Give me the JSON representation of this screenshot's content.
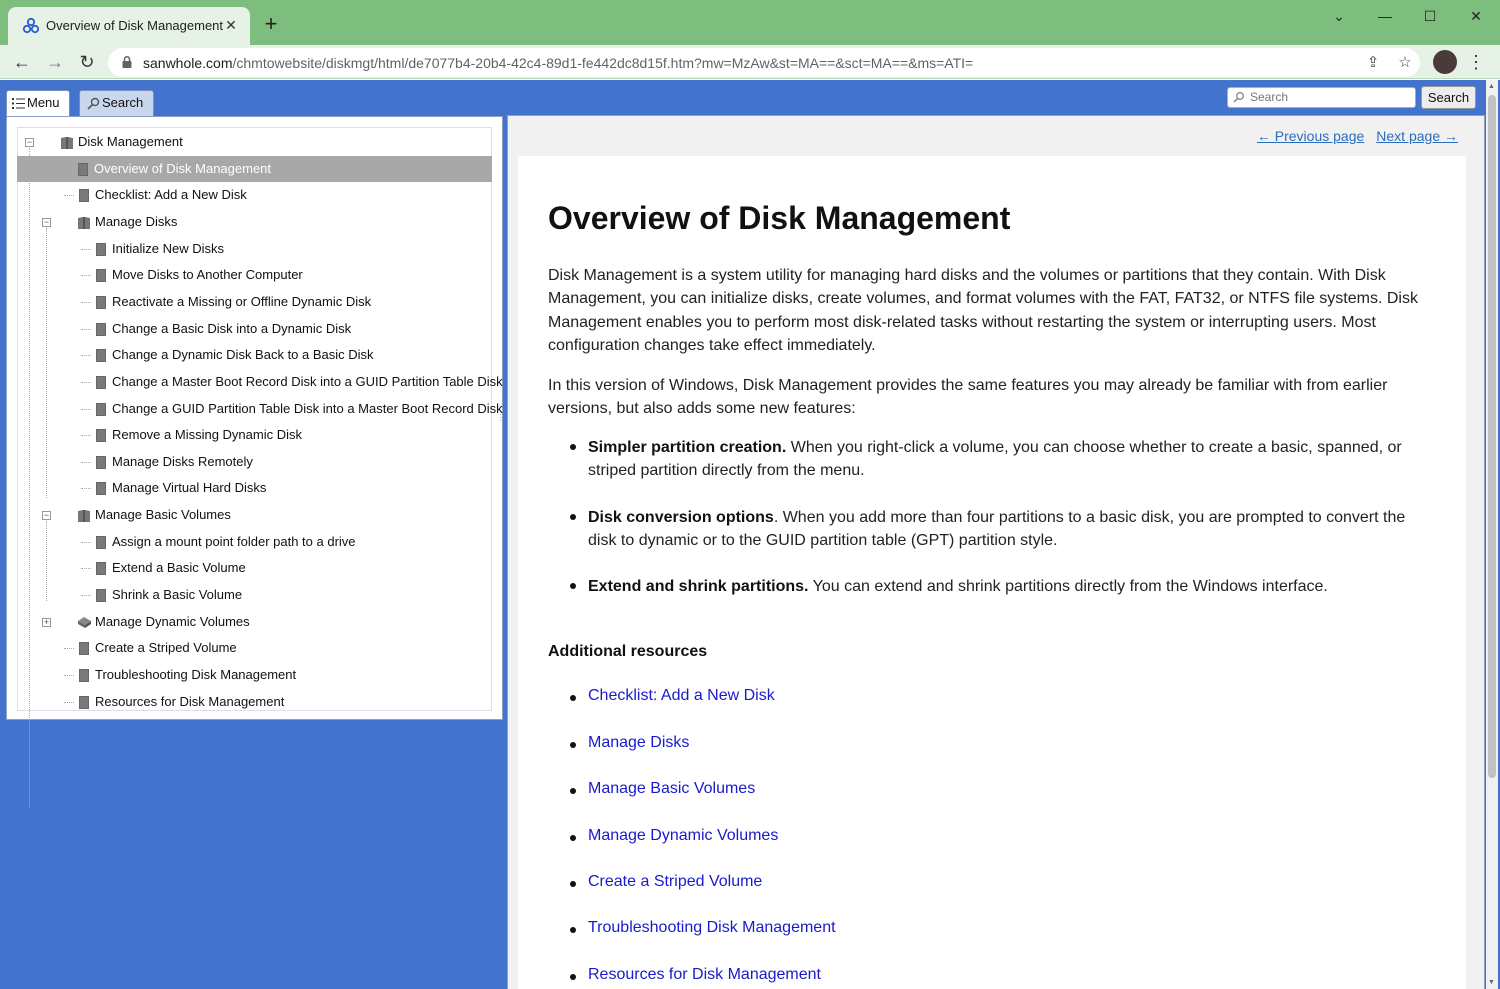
{
  "browser": {
    "tab_title": "Overview of Disk Management",
    "tab_close": "✕",
    "new_tab": "+",
    "minimize": "—",
    "maximize": "☐",
    "close": "✕",
    "chevron": "⌄",
    "url_host": "sanwhole.com",
    "url_path": "/chmtowebsite/diskmgt/html/de7077b4-20b4-42c4-89d1-fe442dc8d15f.htm?mw=MzAw&st=MA==&sct=MA==&ms=ATI=",
    "back": "←",
    "forward": "→",
    "reload": "↻",
    "kebab": "⋮",
    "share": "⇪",
    "star": "☆"
  },
  "panel_tabs": {
    "menu": "Menu",
    "search": "Search"
  },
  "top_search": {
    "placeholder": "Search",
    "button": "Search"
  },
  "tree": [
    {
      "label": "Disk Management",
      "level": 0,
      "type": "book",
      "toggle": "−"
    },
    {
      "label": "Overview of Disk Management",
      "level": 1,
      "type": "page",
      "selected": true
    },
    {
      "label": "Checklist: Add a New Disk",
      "level": 1,
      "type": "page"
    },
    {
      "label": "Manage Disks",
      "level": 1,
      "type": "book",
      "toggle": "−"
    },
    {
      "label": "Initialize New Disks",
      "level": 2,
      "type": "page"
    },
    {
      "label": "Move Disks to Another Computer",
      "level": 2,
      "type": "page"
    },
    {
      "label": "Reactivate a Missing or Offline Dynamic Disk",
      "level": 2,
      "type": "page"
    },
    {
      "label": "Change a Basic Disk into a Dynamic Disk",
      "level": 2,
      "type": "page"
    },
    {
      "label": "Change a Dynamic Disk Back to a Basic Disk",
      "level": 2,
      "type": "page"
    },
    {
      "label": "Change a Master Boot Record Disk into a GUID Partition Table Disk",
      "level": 2,
      "type": "page"
    },
    {
      "label": "Change a GUID Partition Table Disk into a Master Boot Record Disk",
      "level": 2,
      "type": "page"
    },
    {
      "label": "Remove a Missing Dynamic Disk",
      "level": 2,
      "type": "page"
    },
    {
      "label": "Manage Disks Remotely",
      "level": 2,
      "type": "page"
    },
    {
      "label": "Manage Virtual Hard Disks",
      "level": 2,
      "type": "page"
    },
    {
      "label": "Manage Basic Volumes",
      "level": 1,
      "type": "book",
      "toggle": "−"
    },
    {
      "label": "Assign a mount point folder path to a drive",
      "level": 2,
      "type": "page"
    },
    {
      "label": "Extend a Basic Volume",
      "level": 2,
      "type": "page"
    },
    {
      "label": "Shrink a Basic Volume",
      "level": 2,
      "type": "page"
    },
    {
      "label": "Manage Dynamic Volumes",
      "level": 1,
      "type": "closed-book",
      "toggle": "+"
    },
    {
      "label": "Create a Striped Volume",
      "level": 1,
      "type": "page"
    },
    {
      "label": "Troubleshooting Disk Management",
      "level": 1,
      "type": "page"
    },
    {
      "label": "Resources for Disk Management",
      "level": 1,
      "type": "page"
    }
  ],
  "nav": {
    "previous": "← Previous page",
    "next": "Next page →"
  },
  "article": {
    "title": "Overview of Disk Management",
    "para1": "Disk Management is a system utility for managing hard disks and the volumes or partitions that they contain. With Disk Management, you can initialize disks, create volumes, and format volumes with the FAT, FAT32, or NTFS file systems. Disk Management enables you to perform most disk-related tasks without restarting the system or interrupting users. Most configuration changes take effect immediately.",
    "para2": "In this version of Windows, Disk Management provides the same features you may already be familiar with from earlier versions, but also adds some new features:",
    "features": [
      {
        "bold": "Simpler partition creation.",
        "text": " When you right-click a volume, you can choose whether to create a basic, spanned, or striped partition directly from the menu."
      },
      {
        "bold": "Disk conversion options",
        "text": ". When you add more than four partitions to a basic disk, you are prompted to convert the disk to dynamic or to the GUID partition table (GPT) partition style."
      },
      {
        "bold": "Extend and shrink partitions.",
        "text": " You can extend and shrink partitions directly from the Windows interface."
      }
    ],
    "resources_heading": "Additional resources",
    "resources": [
      "Checklist: Add a New Disk",
      "Manage Disks",
      "Manage Basic Volumes",
      "Manage Dynamic Volumes",
      "Create a Striped Volume",
      "Troubleshooting Disk Management",
      "Resources for Disk Management"
    ]
  }
}
